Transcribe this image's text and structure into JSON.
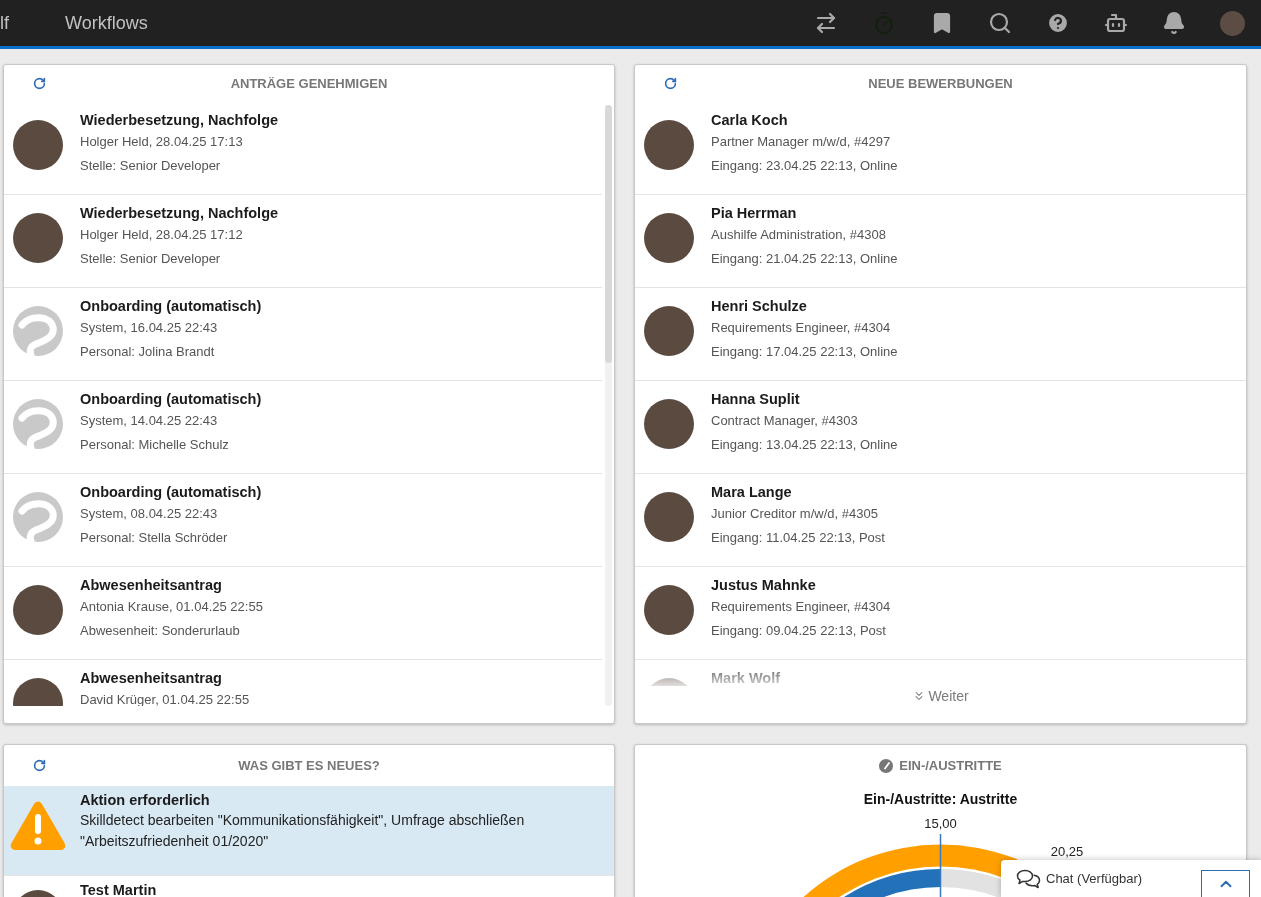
{
  "nav": {
    "tabs": [
      {
        "label": "lf"
      },
      {
        "label": "Workflows"
      }
    ]
  },
  "approvals": {
    "title": "ANTRÄGE GENEHMIGEN",
    "items": [
      {
        "kind": "person",
        "title": "Wiederbesetzung, Nachfolge",
        "lines": [
          "Holger Held, 28.04.25 17:13",
          "Stelle: Senior Developer"
        ]
      },
      {
        "kind": "person",
        "title": "Wiederbesetzung, Nachfolge",
        "lines": [
          "Holger Held, 28.04.25 17:12",
          "Stelle: Senior Developer"
        ]
      },
      {
        "kind": "system",
        "title": "Onboarding (automatisch)",
        "lines": [
          "System, 16.04.25 22:43",
          "Personal: Jolina Brandt"
        ]
      },
      {
        "kind": "system",
        "title": "Onboarding (automatisch)",
        "lines": [
          "System, 14.04.25 22:43",
          "Personal: Michelle Schulz"
        ]
      },
      {
        "kind": "system",
        "title": "Onboarding (automatisch)",
        "lines": [
          "System, 08.04.25 22:43",
          "Personal: Stella Schröder"
        ]
      },
      {
        "kind": "person",
        "title": "Abwesenheitsantrag",
        "lines": [
          "Antonia Krause, 01.04.25 22:55",
          "Abwesenheit: Sonderurlaub"
        ]
      },
      {
        "kind": "person",
        "title": "Abwesenheitsantrag",
        "lines": [
          "David Krüger, 01.04.25 22:55"
        ]
      }
    ]
  },
  "applications": {
    "title": "NEUE BEWERBUNGEN",
    "items": [
      {
        "kind": "person",
        "title": "Carla Koch",
        "lines": [
          "Partner Manager m/w/d, #4297",
          "Eingang: 23.04.25 22:13, Online"
        ]
      },
      {
        "kind": "person",
        "title": "Pia Herrman",
        "lines": [
          "Aushilfe Administration, #4308",
          "Eingang: 21.04.25 22:13, Online"
        ]
      },
      {
        "kind": "person",
        "title": "Henri Schulze",
        "lines": [
          "Requirements Engineer, #4304",
          "Eingang: 17.04.25 22:13, Online"
        ]
      },
      {
        "kind": "person",
        "title": "Hanna Suplit",
        "lines": [
          "Contract Manager, #4303",
          "Eingang: 13.04.25 22:13, Online"
        ]
      },
      {
        "kind": "person",
        "title": "Mara Lange",
        "lines": [
          "Junior Creditor m/w/d, #4305",
          "Eingang: 11.04.25 22:13, Post"
        ]
      },
      {
        "kind": "person",
        "title": "Justus Mahnke",
        "lines": [
          "Requirements Engineer, #4304",
          "Eingang: 09.04.25 22:13, Post"
        ]
      },
      {
        "kind": "person",
        "title": "Mark Wolf"
      }
    ],
    "more": "Weiter"
  },
  "news": {
    "title": "WAS GIBT ES NEUES?",
    "items": [
      {
        "kind": "warning",
        "highlighted": true,
        "title": "Aktion erforderlich",
        "text": "Skilldetect bearbeiten \"Kommunikationsfähigkeit\", Umfrage abschließen \"Arbeitszufriedenheit 01/2020\""
      },
      {
        "kind": "person",
        "highlighted": false,
        "title": "Test Martin"
      }
    ]
  },
  "entries_exits": {
    "title": "EIN-/AUSTRITTE",
    "chart": {
      "title": "Ein-/Austritte: Austritte",
      "labels": [
        "15,00",
        "20,25"
      ]
    }
  },
  "chat": {
    "label": "Chat (Verfügbar)"
  }
}
